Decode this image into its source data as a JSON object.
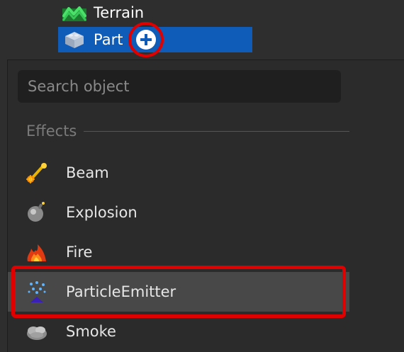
{
  "explorer": {
    "terrain_label": "Terrain",
    "part_label": "Part"
  },
  "insert_menu": {
    "search_placeholder": "Search object",
    "section_title": "Effects",
    "items": [
      {
        "label": "Beam",
        "icon": "beam-icon"
      },
      {
        "label": "Explosion",
        "icon": "explosion-icon"
      },
      {
        "label": "Fire",
        "icon": "fire-icon"
      },
      {
        "label": "ParticleEmitter",
        "icon": "particle-emitter-icon",
        "selected": true
      },
      {
        "label": "Smoke",
        "icon": "smoke-icon"
      }
    ]
  },
  "colors": {
    "selection_blue": "#0f5bb8",
    "annotation_red": "#e10000",
    "panel_bg": "#2b2b2b"
  }
}
